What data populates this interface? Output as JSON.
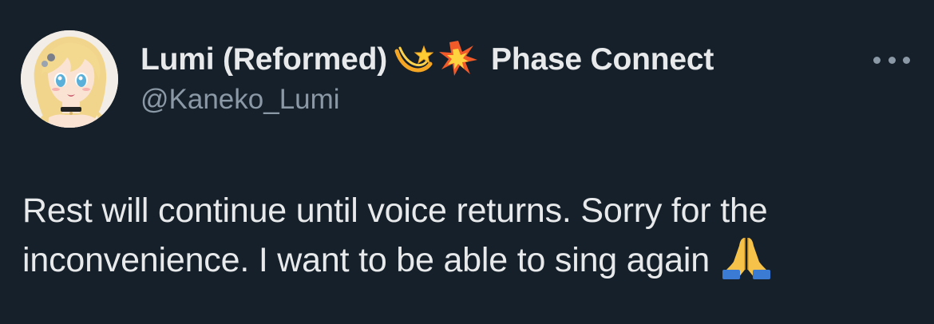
{
  "author": {
    "display_name": "Lumi (Reformed)",
    "name_icons": [
      "dizzy-star-icon",
      "collision-icon"
    ],
    "affiliation": "Phase Connect",
    "handle": "@Kaneko_Lumi",
    "avatar": "avatar-anime-girl"
  },
  "menu": {
    "icon": "more-options-icon"
  },
  "tweet": {
    "text": "Rest will continue until voice returns. Sorry for the inconvenience. I want to be able to sing again",
    "trailing_emoji": "folded-hands-icon"
  },
  "colors": {
    "background": "#15202b",
    "primary_text": "#e7e9ea",
    "secondary_text": "#8b98a5"
  }
}
